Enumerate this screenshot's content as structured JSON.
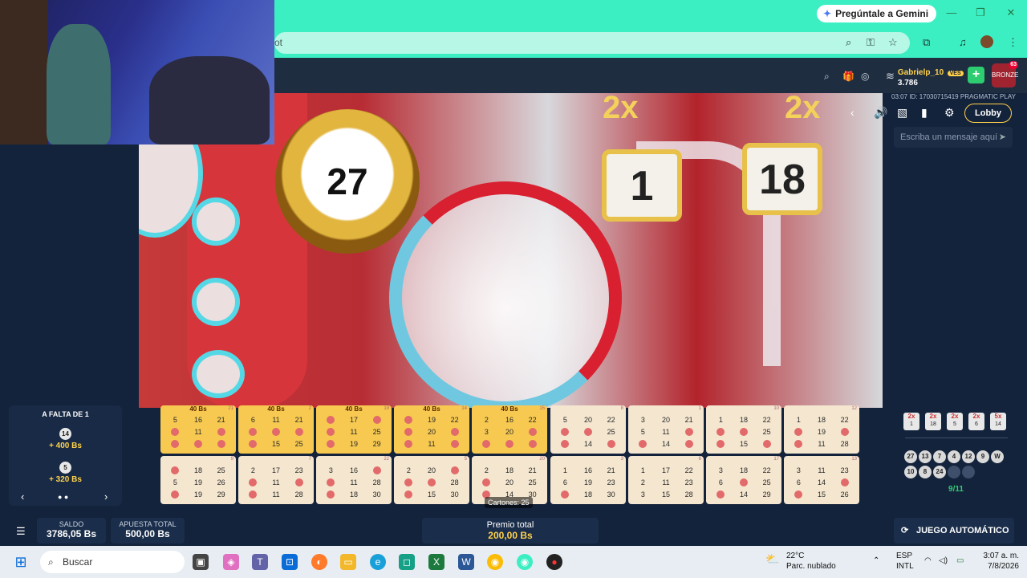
{
  "browser": {
    "gemini_label": "Pregúntale a Gemini",
    "address_text": "ot"
  },
  "site": {
    "username": "Gabrielp_10",
    "currency_badge": "VES",
    "balance": "3.786",
    "level_badge": "BRONZE",
    "notif_count": "63",
    "game_id": "03:07 ID: 17030715419 PRAGMATIC PLAY",
    "lobby_label": "Lobby",
    "chat_placeholder": "Escriba un mensaje aquí"
  },
  "stage": {
    "big_ball": "27",
    "multiplier_left": "2x",
    "multiplier_right": "2x",
    "slot_a": "1",
    "slot_b": "18"
  },
  "ticker": {
    "title": "A FALTA DE 1",
    "items": [
      {
        "ball": "14",
        "prize": "+ 400 Bs"
      },
      {
        "ball": "5",
        "prize": "+ 320 Bs"
      }
    ]
  },
  "cards": [
    {
      "id": "21",
      "prize": "40 Bs",
      "hot": true,
      "cells": [
        "5",
        "16",
        "21",
        "",
        "11",
        "",
        "",
        "",
        ""
      ]
    },
    {
      "id": "2",
      "prize": "40 Bs",
      "hot": true,
      "cells": [
        "6",
        "11",
        "21",
        "",
        "",
        "",
        "",
        "15",
        "25"
      ]
    },
    {
      "id": "19",
      "prize": "40 Bs",
      "hot": true,
      "cells": [
        "",
        "17",
        "",
        "",
        "11",
        "25",
        "",
        "19",
        "29"
      ]
    },
    {
      "id": "14",
      "prize": "40 Bs",
      "hot": true,
      "cells": [
        "",
        "19",
        "22",
        "",
        "20",
        "",
        "",
        "11",
        ""
      ]
    },
    {
      "id": "15",
      "prize": "40 Bs",
      "hot": true,
      "cells": [
        "2",
        "16",
        "22",
        "3",
        "20",
        "",
        "",
        "",
        ""
      ]
    },
    {
      "id": "8",
      "prize": "",
      "hot": false,
      "cells": [
        "5",
        "20",
        "22",
        "",
        "",
        "25",
        "",
        "14",
        ""
      ]
    },
    {
      "id": "1",
      "prize": "",
      "hot": false,
      "cells": [
        "3",
        "20",
        "21",
        "5",
        "11",
        "",
        "",
        "14",
        ""
      ]
    },
    {
      "id": "10",
      "prize": "",
      "hot": false,
      "cells": [
        "1",
        "18",
        "22",
        "",
        "",
        "25",
        "",
        "15",
        ""
      ]
    },
    {
      "id": "12",
      "prize": "",
      "hot": false,
      "cells": [
        "1",
        "18",
        "22",
        "",
        "19",
        "",
        "",
        "11",
        "28"
      ]
    },
    {
      "id": "9",
      "prize": "",
      "hot": false,
      "cells": [
        "",
        "18",
        "25",
        "5",
        "19",
        "26",
        "",
        "19",
        "29"
      ]
    },
    {
      "id": "7",
      "prize": "",
      "hot": false,
      "cells": [
        "2",
        "17",
        "23",
        "",
        "11",
        "",
        "",
        "11",
        "28"
      ]
    },
    {
      "id": "22",
      "prize": "",
      "hot": false,
      "cells": [
        "3",
        "16",
        "",
        "",
        "11",
        "28",
        "",
        "18",
        "30"
      ]
    },
    {
      "id": "5",
      "prize": "",
      "hot": false,
      "cells": [
        "2",
        "20",
        "",
        "",
        "",
        "28",
        "",
        "15",
        "30"
      ]
    },
    {
      "id": "20",
      "prize": "",
      "hot": false,
      "cells": [
        "2",
        "18",
        "21",
        "",
        "20",
        "25",
        "",
        "14",
        "30"
      ]
    },
    {
      "id": "3",
      "prize": "",
      "hot": false,
      "cells": [
        "1",
        "16",
        "21",
        "6",
        "19",
        "23",
        "",
        "18",
        "30"
      ]
    },
    {
      "id": "6",
      "prize": "",
      "hot": false,
      "cells": [
        "1",
        "17",
        "22",
        "2",
        "11",
        "23",
        "3",
        "15",
        "28"
      ]
    },
    {
      "id": "17",
      "prize": "",
      "hot": false,
      "cells": [
        "3",
        "18",
        "22",
        "6",
        "",
        "25",
        "",
        "14",
        "29"
      ]
    },
    {
      "id": "13",
      "prize": "",
      "hot": false,
      "cells": [
        "3",
        "11",
        "23",
        "6",
        "14",
        "",
        "",
        "15",
        "26"
      ]
    }
  ],
  "cartones_label": "Cartones: 25",
  "multipliers": [
    {
      "m": "2x",
      "n": "1"
    },
    {
      "m": "2x",
      "n": "18"
    },
    {
      "m": "2x",
      "n": "5"
    },
    {
      "m": "2x",
      "n": "6"
    },
    {
      "m": "5x",
      "n": "14"
    }
  ],
  "drawn_balls": [
    "27",
    "13",
    "7",
    "4",
    "12",
    "9",
    "W",
    "10",
    "8",
    "24",
    "",
    ""
  ],
  "drawn_count": "9",
  "drawn_total": "/11",
  "bottom": {
    "saldo_label": "SALDO",
    "saldo_value": "3786,05 Bs",
    "apuesta_label": "APUESTA TOTAL",
    "apuesta_value": "500,00 Bs",
    "premio_label": "Premio total",
    "premio_value": "200,00 Bs",
    "auto_label": "JUEGO AUTOMÁTICO"
  },
  "taskbar": {
    "search_placeholder": "Buscar",
    "weather_temp": "22°C",
    "weather_desc": "Parc. nublado",
    "lang_top": "ESP",
    "lang_bottom": "INTL",
    "time": "3:07 a. m.",
    "date": "7/8/2026"
  },
  "colors": {
    "accent": "#3cefc3",
    "gold": "#ffd24a",
    "panel": "#1a2d4a"
  }
}
